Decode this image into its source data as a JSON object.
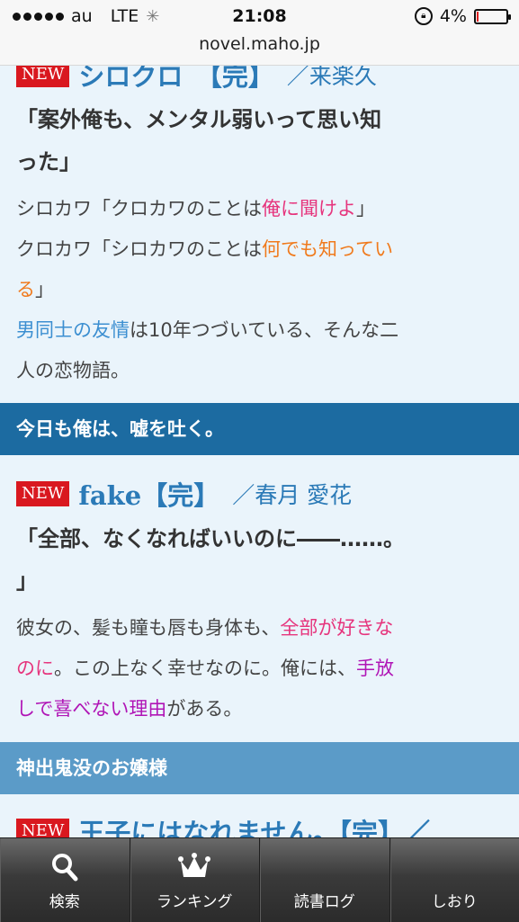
{
  "status_bar": {
    "carrier": "au",
    "network": "LTE",
    "time": "21:08",
    "battery": "4%",
    "battery_level": 0.04
  },
  "url_bar": {
    "domain": "novel.maho.jp"
  },
  "entries": [
    {
      "badge": "NEW",
      "title": "シロクロ　【完】",
      "author": "／来楽久",
      "catch_line1": "「案外俺も、メンタル弱いって思い知",
      "catch_line2": "った」",
      "summary": {
        "l1a": "シロカワ「クロカワのことは",
        "l1b": "俺に聞けよ",
        "l1c": "」",
        "l2a": "クロカワ「シロカワのことは",
        "l2b": "何でも知ってい",
        "l3a": "る",
        "l3b": "」",
        "l4a": "男同士の友情",
        "l4b": "は10年つづいている、そんな二",
        "l5": "人の恋物語。"
      }
    },
    {
      "badge": "NEW",
      "title": "fake【完】",
      "author": "／春月 愛花",
      "catch_line1": "「全部、なくなればいいのに――……。",
      "catch_line2": "」",
      "summary": {
        "l1a": "彼女の、髪も瞳も唇も身体も、",
        "l1b": "全部が好きな",
        "l2a": "のに",
        "l2b": "。この上なく幸せなのに。俺には、",
        "l2c": "手放",
        "l3a": "しで喜べない理由",
        "l3b": "がある。"
      }
    },
    {
      "badge": "NEW",
      "title": "王子にはなれません。【完】／"
    }
  ],
  "sections": [
    {
      "title": "今日も俺は、嘘を吐く。"
    },
    {
      "title": "神出鬼没のお嬢様"
    }
  ],
  "tab_bar": {
    "tabs": [
      {
        "label": "検索",
        "icon": "search-icon"
      },
      {
        "label": "ランキング",
        "icon": "crown-icon"
      },
      {
        "label": "読書ログ",
        "icon": ""
      },
      {
        "label": "しおり",
        "icon": ""
      }
    ]
  },
  "colors": {
    "background": "#eaf4fb",
    "title_blue": "#2b7ab7",
    "section_dark": "#1c6ba1",
    "section_light": "#5b9bc8",
    "badge_red": "#d9181f",
    "highlight_pink": "#e6357d",
    "highlight_orange": "#f07a1c",
    "highlight_blue": "#3c8fd1",
    "highlight_purple": "#b015b6"
  }
}
